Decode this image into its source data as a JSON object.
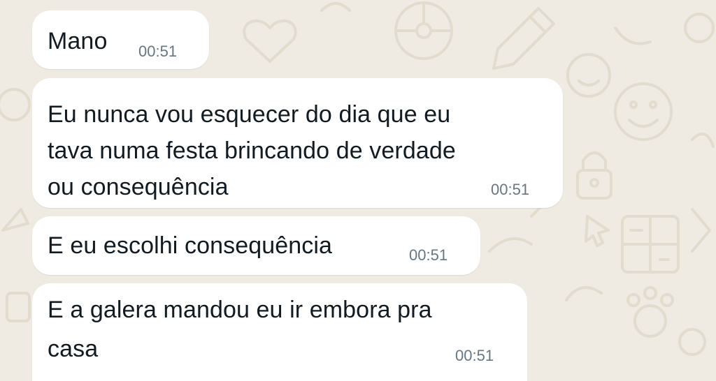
{
  "chat": {
    "messages": [
      {
        "text": "Mano",
        "time": "00:51"
      },
      {
        "text": "Eu nunca vou esquecer do dia que eu\ntava numa festa brincando de verdade\nou consequência",
        "time": "00:51"
      },
      {
        "text": "E eu escolhi consequência",
        "time": "00:51"
      },
      {
        "text": "E a galera mandou eu ir embora pra\ncasa",
        "time": "00:51"
      }
    ]
  },
  "colors": {
    "background": "#efeae2",
    "bubble": "#ffffff",
    "text": "#111b21",
    "timestamp": "#667781",
    "doodle": "#e2dccf"
  },
  "icons": [
    "smiley-doodle-icon",
    "heart-doodle-icon",
    "pencil-doodle-icon",
    "steering-wheel-doodle-icon",
    "lock-doodle-icon",
    "calculator-doodle-icon",
    "paw-doodle-icon",
    "cursor-doodle-icon"
  ]
}
